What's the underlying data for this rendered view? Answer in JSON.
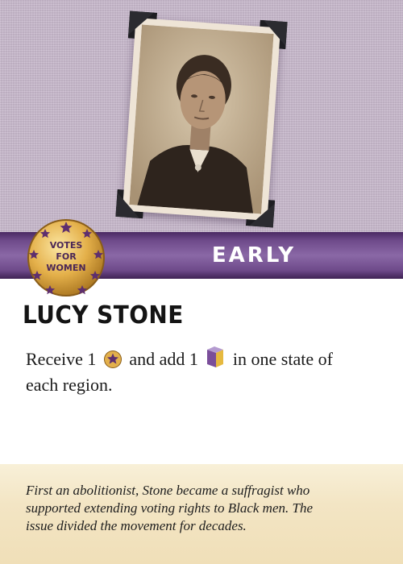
{
  "card": {
    "era": "EARLY",
    "name": "LUCY STONE",
    "badge": {
      "line1": "VOTES",
      "line2": "FOR",
      "line3": "WOMEN"
    },
    "ability": {
      "line1_part1": "Receive 1",
      "line1_icon1": "star-token-icon",
      "line1_part2": "and add 1",
      "line1_icon2": "purple-yellow-cube-icon",
      "line1_part3": "in one state of",
      "line2": "each region."
    },
    "flavor": {
      "line1": "First an abolitionist, Stone became a suffragist who",
      "line2": "supported extending voting rights to Black men. The",
      "line3": "issue divided the movement for decades."
    },
    "colors": {
      "banner": "#6e4a8a",
      "linen": "#c8b9cc",
      "badge_gold": "#d9a53a",
      "star": "#5e2f6e",
      "parchment": "#f3e5c4"
    }
  }
}
